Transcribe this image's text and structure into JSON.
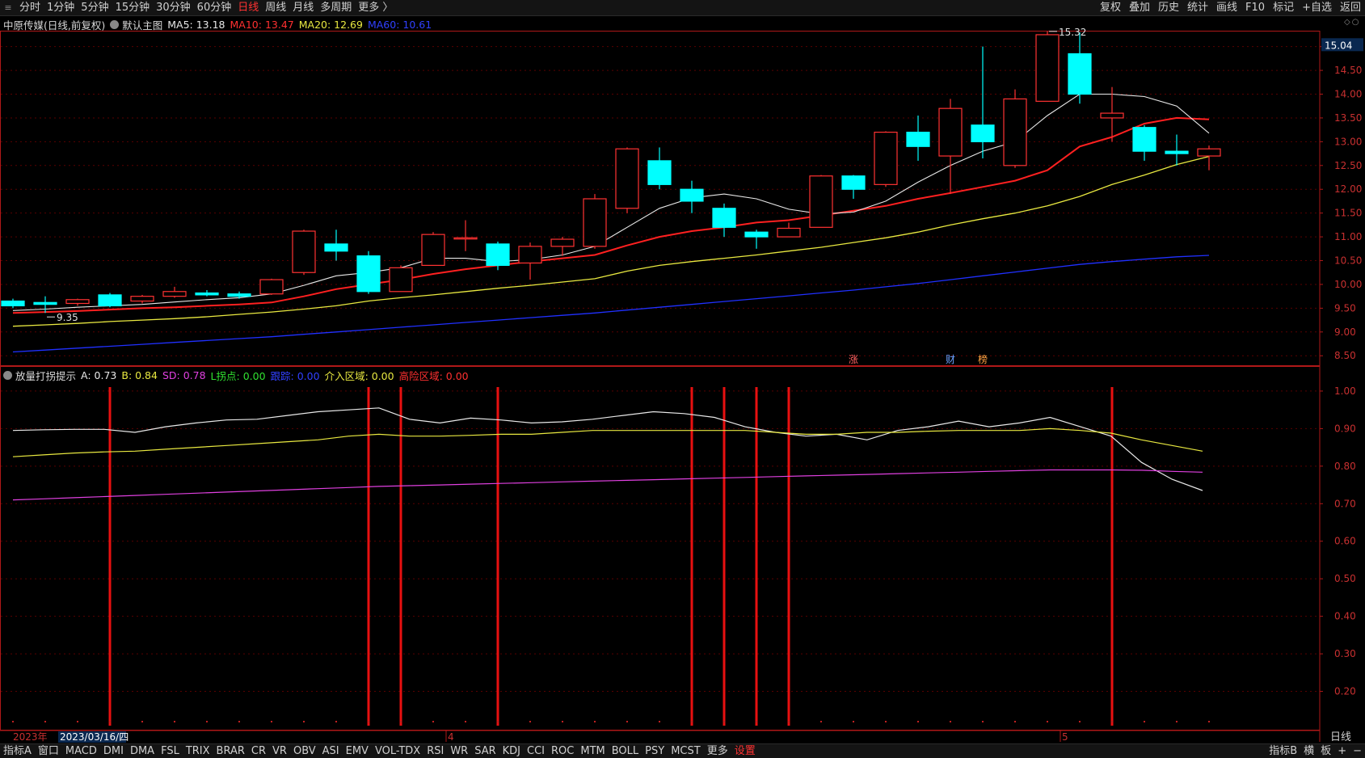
{
  "topbar": {
    "periods": [
      {
        "label": "分时",
        "active": false
      },
      {
        "label": "1分钟",
        "active": false
      },
      {
        "label": "5分钟",
        "active": false
      },
      {
        "label": "15分钟",
        "active": false
      },
      {
        "label": "30分钟",
        "active": false
      },
      {
        "label": "60分钟",
        "active": false
      },
      {
        "label": "日线",
        "active": true
      },
      {
        "label": "周线",
        "active": false
      },
      {
        "label": "月线",
        "active": false
      },
      {
        "label": "多周期",
        "active": false
      },
      {
        "label": "更多 〉",
        "active": false
      }
    ],
    "tools": [
      "复权",
      "叠加",
      "历史",
      "统计",
      "画线",
      "F10",
      "标记",
      "+自选",
      "返回"
    ]
  },
  "main_info": {
    "stock": "中原传媒(日线,前复权)",
    "template": "默认主图",
    "ma5": "MA5: 13.18",
    "ma10": "MA10: 13.47",
    "ma20": "MA20: 12.69",
    "ma60": "MA60: 10.61"
  },
  "sub_info": {
    "name": "放量打拐提示",
    "a": "A: 0.73",
    "b": "B: 0.84",
    "sd": "SD: 0.78",
    "l": "L拐点: 0.00",
    "trace": "跟踪: 0.00",
    "enter": "介入区域: 0.00",
    "risk": "高险区域: 0.00"
  },
  "colors": {
    "up": "#ff3232",
    "down": "#00ffff",
    "ma5": "#e8e8e8",
    "ma10": "#ff2020",
    "ma20": "#e8e840",
    "ma60": "#2030ff",
    "sd": "#e040e0",
    "grid": "#5a0000",
    "axis": "#b01818"
  },
  "chart_data": [
    {
      "type": "candlestick",
      "title": "中原传媒(日线,前复权)",
      "ylim": [
        8.3,
        15.3
      ],
      "y_ticks": [
        8.5,
        9.0,
        9.5,
        10.0,
        10.5,
        11.0,
        11.5,
        12.0,
        12.5,
        13.0,
        13.5,
        14.0,
        14.5,
        15.0
      ],
      "current_price": "15.04",
      "high_label": "15.32",
      "low_label": "9.35",
      "candles": [
        {
          "o": 9.65,
          "c": 9.55,
          "h": 9.7,
          "l": 9.5
        },
        {
          "o": 9.62,
          "c": 9.58,
          "h": 9.75,
          "l": 9.4
        },
        {
          "o": 9.6,
          "c": 9.68,
          "h": 9.7,
          "l": 9.55
        },
        {
          "o": 9.78,
          "c": 9.55,
          "h": 9.82,
          "l": 9.52
        },
        {
          "o": 9.65,
          "c": 9.75,
          "h": 9.78,
          "l": 9.6
        },
        {
          "o": 9.75,
          "c": 9.85,
          "h": 9.95,
          "l": 9.72
        },
        {
          "o": 9.82,
          "c": 9.78,
          "h": 9.88,
          "l": 9.75
        },
        {
          "o": 9.8,
          "c": 9.75,
          "h": 9.85,
          "l": 9.7
        },
        {
          "o": 9.8,
          "c": 10.1,
          "h": 10.12,
          "l": 9.78
        },
        {
          "o": 10.25,
          "c": 11.12,
          "h": 11.15,
          "l": 10.2
        },
        {
          "o": 10.85,
          "c": 10.7,
          "h": 11.15,
          "l": 10.5
        },
        {
          "o": 10.6,
          "c": 9.85,
          "h": 10.7,
          "l": 9.8
        },
        {
          "o": 9.85,
          "c": 10.35,
          "h": 10.4,
          "l": 9.85
        },
        {
          "o": 10.4,
          "c": 11.05,
          "h": 11.1,
          "l": 10.4
        },
        {
          "o": 10.98,
          "c": 10.98,
          "h": 11.35,
          "l": 10.7
        },
        {
          "o": 10.85,
          "c": 10.4,
          "h": 10.9,
          "l": 10.3
        },
        {
          "o": 10.45,
          "c": 10.8,
          "h": 10.88,
          "l": 10.1
        },
        {
          "o": 10.8,
          "c": 10.95,
          "h": 11.0,
          "l": 10.6
        },
        {
          "o": 10.8,
          "c": 11.8,
          "h": 11.9,
          "l": 10.75
        },
        {
          "o": 11.6,
          "c": 12.85,
          "h": 12.88,
          "l": 11.5
        },
        {
          "o": 12.6,
          "c": 12.1,
          "h": 12.88,
          "l": 12.0
        },
        {
          "o": 12.0,
          "c": 11.75,
          "h": 12.18,
          "l": 11.5
        },
        {
          "o": 11.6,
          "c": 11.2,
          "h": 11.7,
          "l": 11.0
        },
        {
          "o": 11.1,
          "c": 11.0,
          "h": 11.15,
          "l": 10.75
        },
        {
          "o": 11.0,
          "c": 11.18,
          "h": 11.3,
          "l": 11.0
        },
        {
          "o": 11.2,
          "c": 12.28,
          "h": 12.3,
          "l": 11.2
        },
        {
          "o": 12.28,
          "c": 12.0,
          "h": 12.3,
          "l": 11.8
        },
        {
          "o": 12.1,
          "c": 13.2,
          "h": 13.22,
          "l": 12.05
        },
        {
          "o": 13.2,
          "c": 12.9,
          "h": 13.55,
          "l": 12.6
        },
        {
          "o": 12.7,
          "c": 13.7,
          "h": 13.9,
          "l": 11.9
        },
        {
          "o": 13.35,
          "c": 13.0,
          "h": 15.0,
          "l": 12.65
        },
        {
          "o": 12.5,
          "c": 13.9,
          "h": 14.1,
          "l": 12.45
        },
        {
          "o": 13.85,
          "c": 15.25,
          "h": 15.32,
          "l": 13.85
        },
        {
          "o": 14.85,
          "c": 14.0,
          "h": 15.3,
          "l": 13.8
        },
        {
          "o": 13.5,
          "c": 13.6,
          "h": 14.15,
          "l": 13.0
        },
        {
          "o": 13.3,
          "c": 12.8,
          "h": 13.35,
          "l": 12.6
        },
        {
          "o": 12.8,
          "c": 12.75,
          "h": 13.15,
          "l": 12.5
        },
        {
          "o": 12.7,
          "c": 12.85,
          "h": 12.92,
          "l": 12.4
        }
      ],
      "ma5": [
        9.45,
        9.48,
        9.52,
        9.55,
        9.58,
        9.63,
        9.68,
        9.72,
        9.8,
        9.98,
        10.18,
        10.25,
        10.35,
        10.55,
        10.55,
        10.48,
        10.52,
        10.62,
        10.8,
        11.2,
        11.6,
        11.82,
        11.9,
        11.8,
        11.58,
        11.48,
        11.52,
        11.75,
        12.15,
        12.5,
        12.8,
        13.0,
        13.55,
        14.0,
        14.0,
        13.95,
        13.75,
        13.18
      ],
      "ma10": [
        9.4,
        9.42,
        9.44,
        9.47,
        9.5,
        9.52,
        9.55,
        9.58,
        9.62,
        9.75,
        9.9,
        10.0,
        10.1,
        10.22,
        10.32,
        10.4,
        10.48,
        10.55,
        10.62,
        10.82,
        11.0,
        11.12,
        11.2,
        11.3,
        11.35,
        11.45,
        11.55,
        11.65,
        11.8,
        11.92,
        12.05,
        12.18,
        12.4,
        12.9,
        13.1,
        13.38,
        13.5,
        13.47
      ],
      "ma20": [
        9.12,
        9.15,
        9.18,
        9.22,
        9.25,
        9.28,
        9.32,
        9.37,
        9.42,
        9.48,
        9.55,
        9.65,
        9.72,
        9.78,
        9.85,
        9.92,
        9.98,
        10.05,
        10.12,
        10.28,
        10.4,
        10.48,
        10.55,
        10.62,
        10.7,
        10.78,
        10.88,
        10.98,
        11.1,
        11.25,
        11.38,
        11.5,
        11.65,
        11.85,
        12.1,
        12.3,
        12.52,
        12.69
      ],
      "ma60": [
        8.58,
        8.62,
        8.66,
        8.7,
        8.74,
        8.78,
        8.82,
        8.86,
        8.9,
        8.95,
        9.0,
        9.05,
        9.1,
        9.15,
        9.2,
        9.25,
        9.3,
        9.35,
        9.4,
        9.46,
        9.52,
        9.58,
        9.64,
        9.7,
        9.76,
        9.82,
        9.88,
        9.95,
        10.02,
        10.1,
        10.18,
        10.26,
        10.34,
        10.42,
        10.48,
        10.53,
        10.58,
        10.61
      ],
      "markers": [
        {
          "index": 26,
          "text": "涨",
          "color": "#ff6060"
        },
        {
          "index": 29,
          "text": "财",
          "color": "#6aa0ff"
        },
        {
          "index": 30,
          "text": "榜",
          "color": "#ffa040"
        }
      ]
    },
    {
      "type": "line",
      "title": "放量打拐提示",
      "ylim": [
        0.1,
        1.03
      ],
      "y_ticks": [
        0.2,
        0.3,
        0.4,
        0.5,
        0.6,
        0.7,
        0.8,
        0.9,
        1.0
      ],
      "series": [
        {
          "name": "A",
          "values": [
            0.895,
            0.897,
            0.898,
            0.898,
            0.89,
            0.905,
            0.915,
            0.923,
            0.925,
            0.935,
            0.945,
            0.95,
            0.955,
            0.925,
            0.915,
            0.928,
            0.923,
            0.915,
            0.918,
            0.925,
            0.935,
            0.945,
            0.94,
            0.93,
            0.905,
            0.89,
            0.88,
            0.885,
            0.87,
            0.895,
            0.905,
            0.92,
            0.905,
            0.915,
            0.93,
            0.905,
            0.88,
            0.81,
            0.765,
            0.735
          ]
        },
        {
          "name": "B",
          "values": [
            0.825,
            0.83,
            0.835,
            0.838,
            0.84,
            0.845,
            0.85,
            0.855,
            0.86,
            0.865,
            0.87,
            0.88,
            0.885,
            0.88,
            0.88,
            0.882,
            0.885,
            0.885,
            0.89,
            0.895,
            0.895,
            0.895,
            0.895,
            0.895,
            0.895,
            0.89,
            0.885,
            0.885,
            0.89,
            0.89,
            0.893,
            0.895,
            0.895,
            0.895,
            0.9,
            0.895,
            0.888,
            0.87,
            0.855,
            0.84
          ]
        },
        {
          "name": "SD",
          "values": [
            0.71,
            0.713,
            0.716,
            0.719,
            0.722,
            0.725,
            0.728,
            0.731,
            0.734,
            0.737,
            0.74,
            0.743,
            0.746,
            0.748,
            0.75,
            0.752,
            0.754,
            0.756,
            0.758,
            0.76,
            0.762,
            0.764,
            0.766,
            0.768,
            0.77,
            0.772,
            0.774,
            0.776,
            0.778,
            0.78,
            0.782,
            0.784,
            0.786,
            0.788,
            0.79,
            0.79,
            0.79,
            0.789,
            0.786,
            0.784
          ]
        }
      ],
      "signal_bars": [
        3,
        11,
        12,
        15,
        21,
        22,
        23,
        24,
        34
      ]
    }
  ],
  "x_axis": {
    "labels": [
      {
        "index": 0,
        "text": "2023年"
      },
      {
        "index": 13,
        "text": "4"
      },
      {
        "index": 32,
        "text": "5"
      }
    ],
    "cursor_date": "2023/03/16/四"
  },
  "period_badge": "日线",
  "bottombar": {
    "tabs": [
      {
        "label": "指标A",
        "active": false
      },
      {
        "label": "窗口",
        "active": false
      },
      {
        "label": "MACD",
        "active": false
      },
      {
        "label": "DMI",
        "active": false
      },
      {
        "label": "DMA",
        "active": false
      },
      {
        "label": "FSL",
        "active": false
      },
      {
        "label": "TRIX",
        "active": false
      },
      {
        "label": "BRAR",
        "active": false
      },
      {
        "label": "CR",
        "active": false
      },
      {
        "label": "VR",
        "active": false
      },
      {
        "label": "OBV",
        "active": false
      },
      {
        "label": "ASI",
        "active": false
      },
      {
        "label": "EMV",
        "active": false
      },
      {
        "label": "VOL-TDX",
        "active": false
      },
      {
        "label": "RSI",
        "active": false
      },
      {
        "label": "WR",
        "active": false
      },
      {
        "label": "SAR",
        "active": false
      },
      {
        "label": "KDJ",
        "active": false
      },
      {
        "label": "CCI",
        "active": false
      },
      {
        "label": "ROC",
        "active": false
      },
      {
        "label": "MTM",
        "active": false
      },
      {
        "label": "BOLL",
        "active": false
      },
      {
        "label": "PSY",
        "active": false
      },
      {
        "label": "MCST",
        "active": false
      },
      {
        "label": "更多",
        "active": false
      },
      {
        "label": "设置",
        "active": true
      }
    ],
    "right": [
      "指标B",
      "横",
      "板",
      "+",
      "−"
    ]
  }
}
